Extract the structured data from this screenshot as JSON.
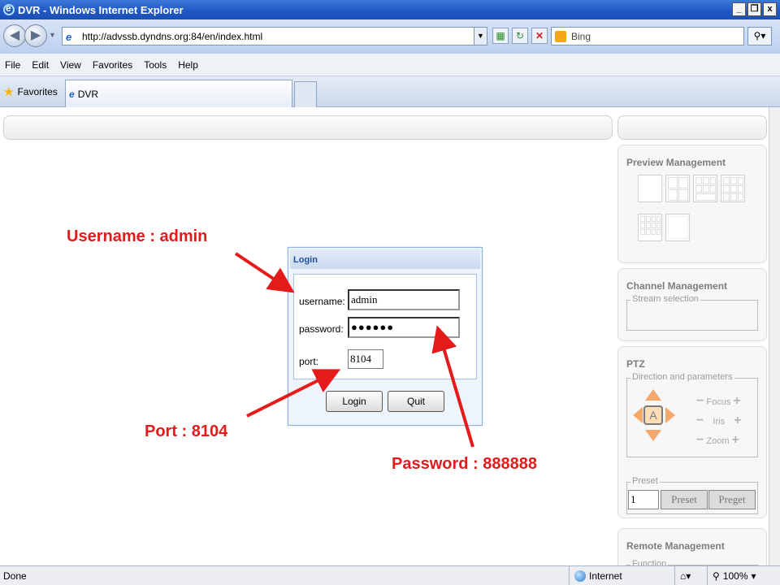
{
  "window": {
    "title": "DVR - Windows Internet Explorer",
    "minimize": "_",
    "restore": "❐",
    "close": "x"
  },
  "addressbar": {
    "url": "http://advssb.dyndns.org:84/en/index.html",
    "search_value": "Bing"
  },
  "menu": {
    "items": [
      "File",
      "Edit",
      "View",
      "Favorites",
      "Tools",
      "Help"
    ]
  },
  "favorites": {
    "label": "Favorites"
  },
  "tab": {
    "title": "DVR"
  },
  "right_panel": {
    "preview": {
      "title": "Preview Management"
    },
    "channel": {
      "title": "Channel Management",
      "legend": "Stream selection"
    },
    "ptz": {
      "title": "PTZ",
      "legend": "Direction and parameters",
      "center_label": "A",
      "focus": "Focus",
      "iris": "Iris",
      "zoom": "Zoom",
      "minus": "−",
      "plus": "+",
      "preset_legend": "Preset",
      "preset_value": "1",
      "preset_btn": "Preset",
      "preget_btn": "Preget"
    },
    "remote": {
      "title": "Remote Management",
      "legend": "Function"
    }
  },
  "login": {
    "title": "Login",
    "username_label": "username:",
    "username_value": "admin",
    "password_label": "password:",
    "password_value": "●●●●●●",
    "port_label": "port:",
    "port_value": "8104",
    "login_btn": "Login",
    "quit_btn": "Quit"
  },
  "annotations": {
    "username": "Username : admin",
    "port": "Port : 8104",
    "password": "Password : 888888",
    "color": "#e51a1a"
  },
  "statusbar": {
    "status": "Done",
    "zone": "Internet",
    "zoom": "100%"
  }
}
